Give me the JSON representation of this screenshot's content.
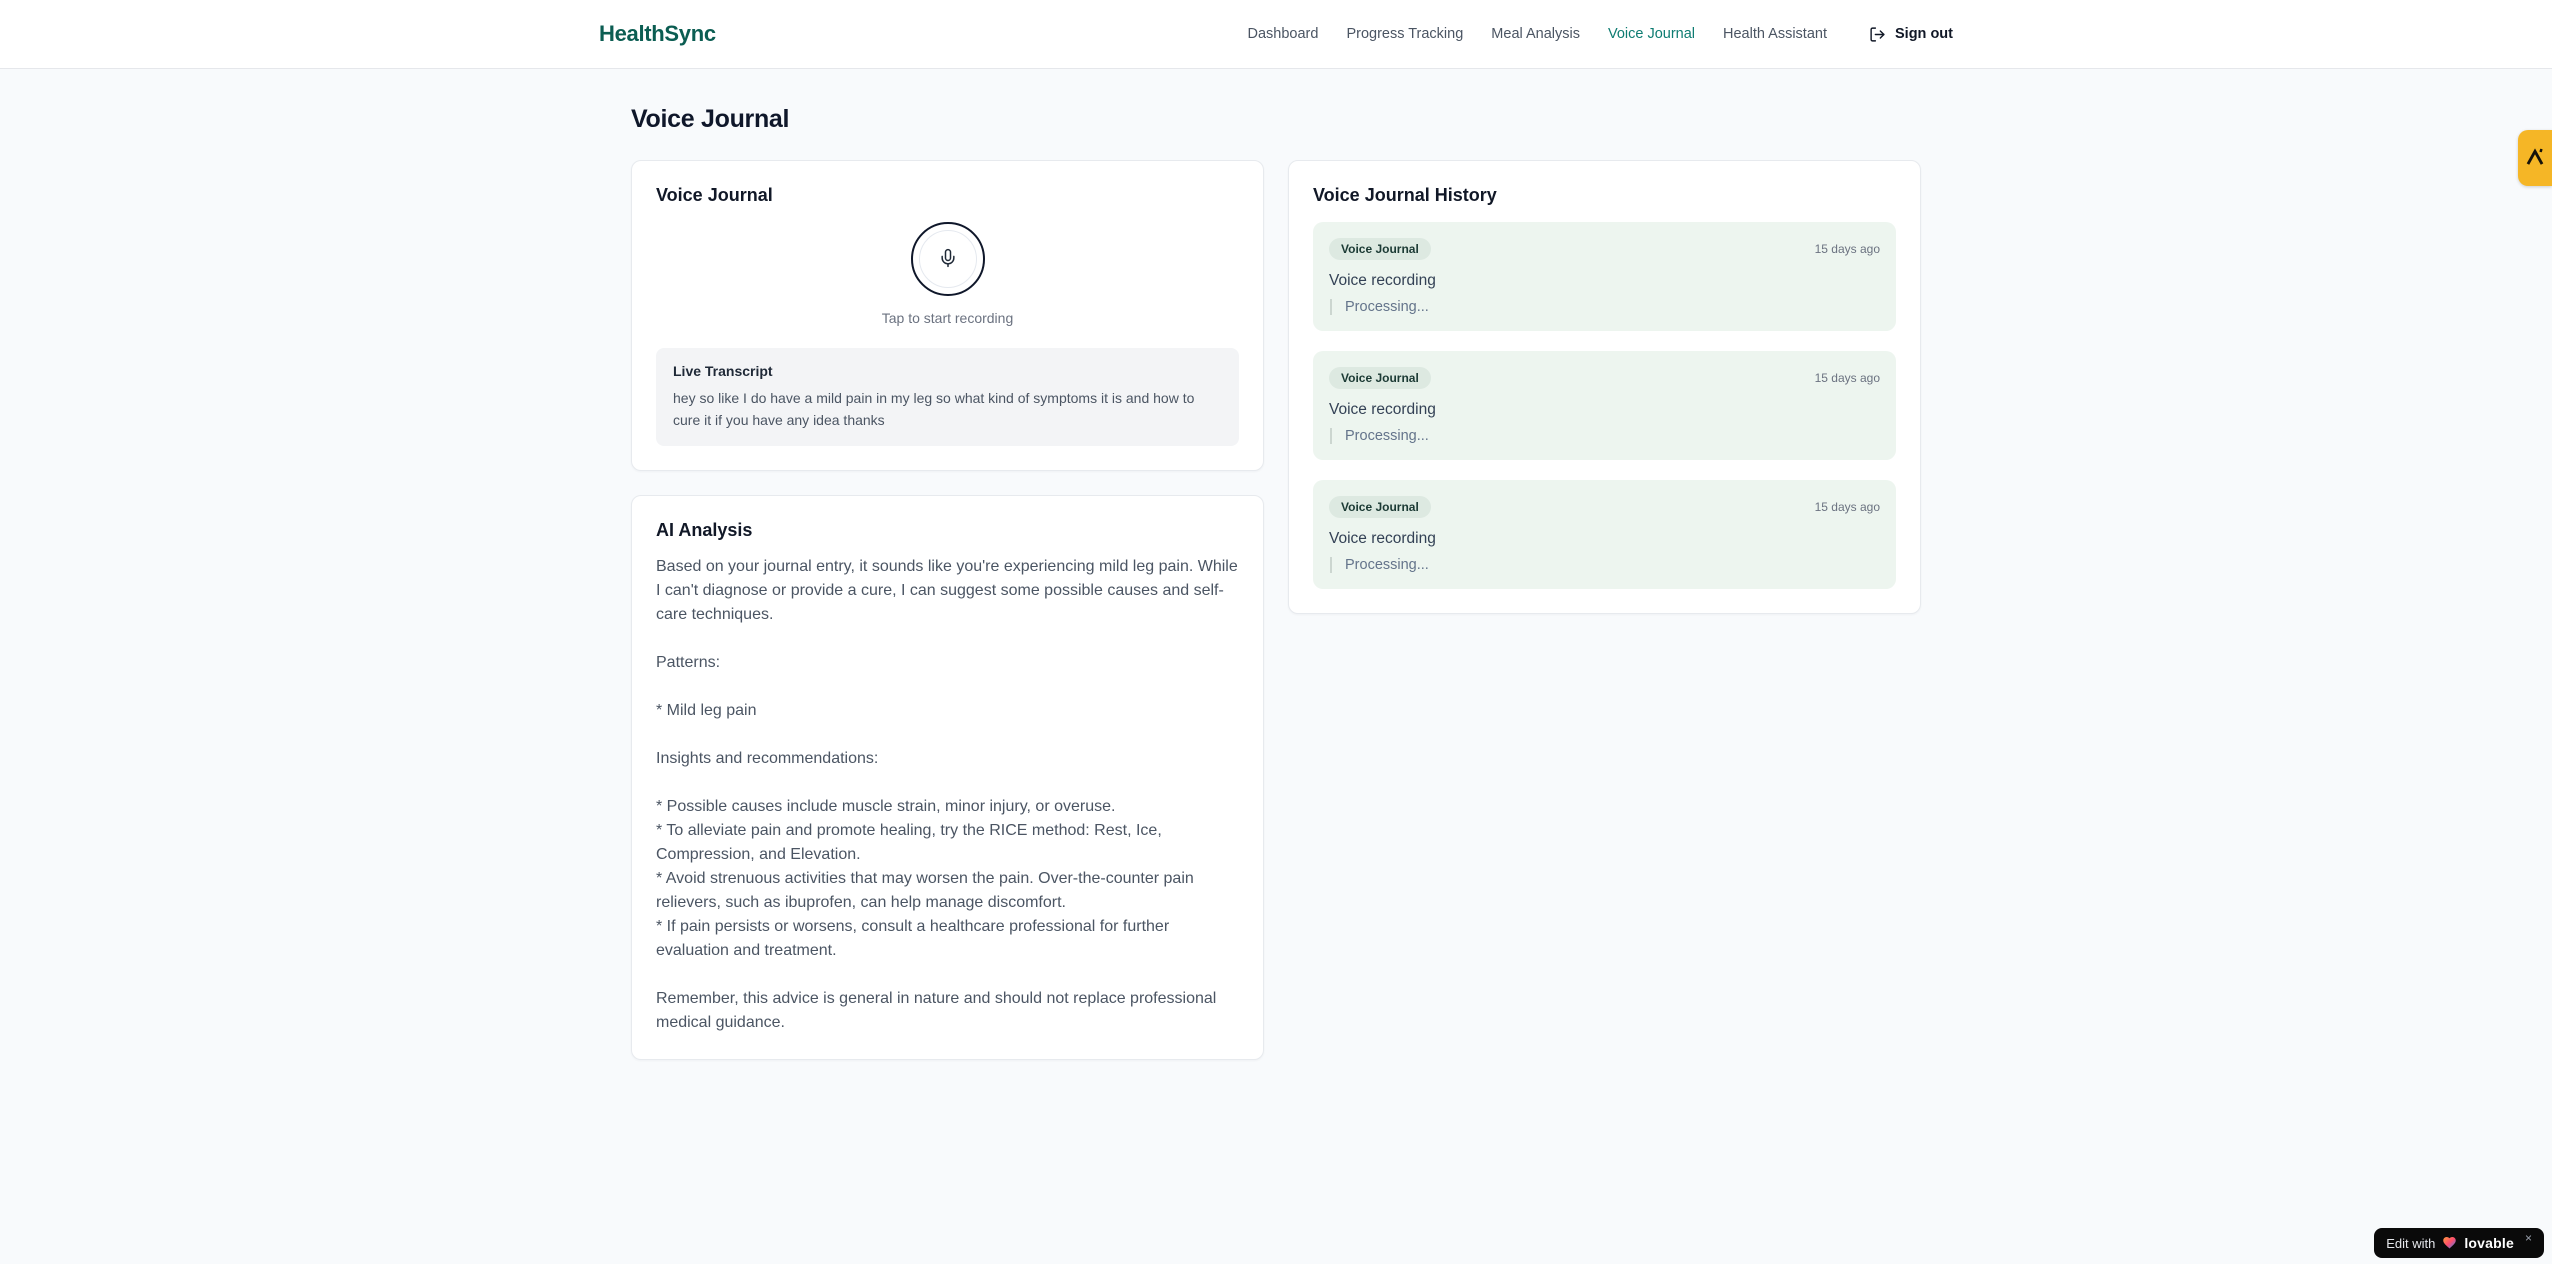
{
  "header": {
    "logo": "HealthSync",
    "nav": [
      {
        "label": "Dashboard"
      },
      {
        "label": "Progress Tracking"
      },
      {
        "label": "Meal Analysis"
      },
      {
        "label": "Voice Journal"
      },
      {
        "label": "Health Assistant"
      }
    ],
    "sign_out_label": "Sign out"
  },
  "page": {
    "title": "Voice Journal"
  },
  "recorder": {
    "title": "Voice Journal",
    "tap_hint": "Tap to start recording",
    "transcript_title": "Live Transcript",
    "transcript_text": "hey so like I do have a mild pain in my leg so what kind of symptoms it is and how to cure it if you have any idea thanks"
  },
  "analysis": {
    "title": "AI Analysis",
    "body": "Based on your journal entry, it sounds like you're experiencing mild leg pain. While I can't diagnose or provide a cure, I can suggest some possible causes and self-care techniques.\n\nPatterns:\n\n* Mild leg pain\n\nInsights and recommendations:\n\n* Possible causes include muscle strain, minor injury, or overuse.\n* To alleviate pain and promote healing, try the RICE method: Rest, Ice, Compression, and Elevation.\n* Avoid strenuous activities that may worsen the pain. Over-the-counter pain relievers, such as ibuprofen, can help manage discomfort.\n* If pain persists or worsens, consult a healthcare professional for further evaluation and treatment.\n\nRemember, this advice is general in nature and should not replace professional medical guidance."
  },
  "history": {
    "title": "Voice Journal History",
    "entries": [
      {
        "badge": "Voice Journal",
        "time": "15 days ago",
        "label": "Voice recording",
        "status": "Processing..."
      },
      {
        "badge": "Voice Journal",
        "time": "15 days ago",
        "label": "Voice recording",
        "status": "Processing..."
      },
      {
        "badge": "Voice Journal",
        "time": "15 days ago",
        "label": "Voice recording",
        "status": "Processing..."
      }
    ]
  },
  "overlays": {
    "edit_prefix": "Edit with",
    "edit_brand": "lovable",
    "edit_close": "×"
  },
  "colors": {
    "brand_teal_dark": "#0b5d52",
    "nav_active_teal": "#0e7c72",
    "history_entry_bg": "#edf5ef",
    "history_badge_bg": "#dde9e1",
    "side_badge_amber": "#f5b626",
    "page_bg": "#f8fafc"
  }
}
